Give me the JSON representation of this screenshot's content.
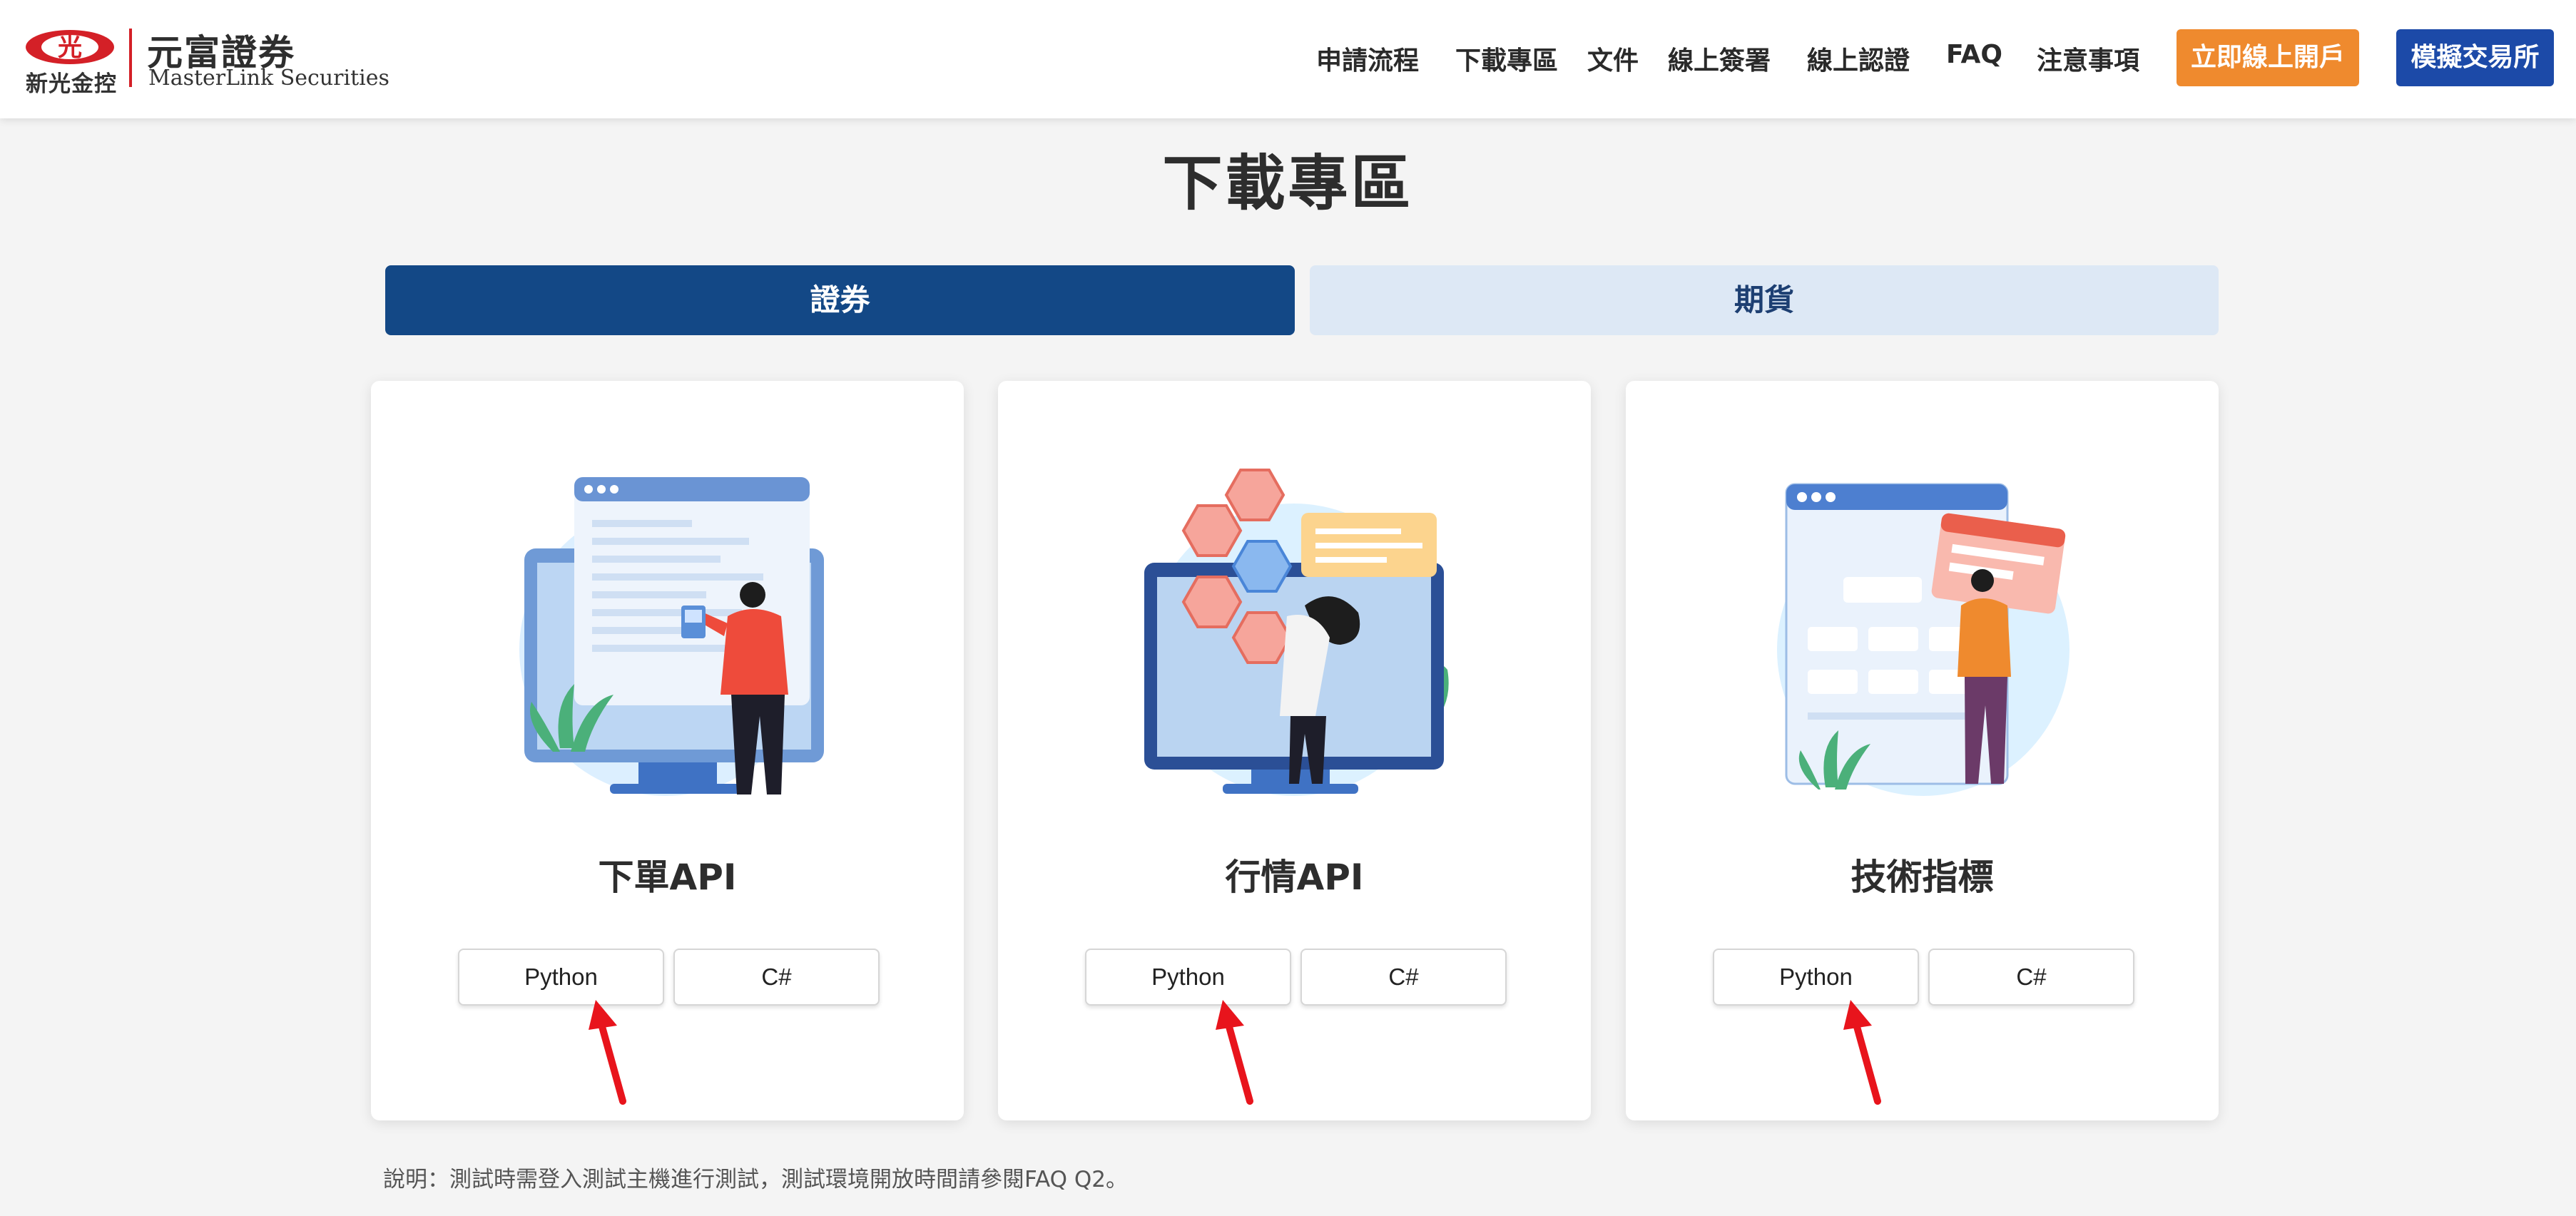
{
  "header": {
    "logo": {
      "mark_text": "光",
      "sub_label": "新光金控",
      "brand": "元富證券",
      "brand_en": "MasterLink Securities"
    },
    "nav": [
      {
        "label": "申請流程"
      },
      {
        "label": "下載專區"
      },
      {
        "label": "文件"
      },
      {
        "label": "線上簽署"
      },
      {
        "label": "線上認證"
      },
      {
        "label": "FAQ"
      },
      {
        "label": "注意事項"
      }
    ],
    "cta_open_account": "立即線上開戶",
    "cta_sim_exchange": "模擬交易所"
  },
  "main": {
    "page_title": "下載專區",
    "tabs": [
      {
        "label": "證券",
        "active": true
      },
      {
        "label": "期貨",
        "active": false
      }
    ],
    "cards": [
      {
        "title": "下單API",
        "buttons": [
          "Python",
          "C#"
        ]
      },
      {
        "title": "行情API",
        "buttons": [
          "Python",
          "C#"
        ]
      },
      {
        "title": "技術指標",
        "buttons": [
          "Python",
          "C#"
        ]
      }
    ],
    "note": "說明：測試時需登入測試主機進行測試，測試環境開放時間請參閱FAQ Q2。"
  },
  "colors": {
    "tab_active_bg": "#134886",
    "tab_inactive_bg": "#dde8f5",
    "cta_orange": "#ef8a2e",
    "cta_blue": "#1c4aa8",
    "logo_red": "#d42027",
    "annotation_arrow": "#e8141c"
  },
  "icons": [
    "red-annotation-arrow-icon",
    "illustration-order-api",
    "illustration-quote-api",
    "illustration-indicator"
  ]
}
